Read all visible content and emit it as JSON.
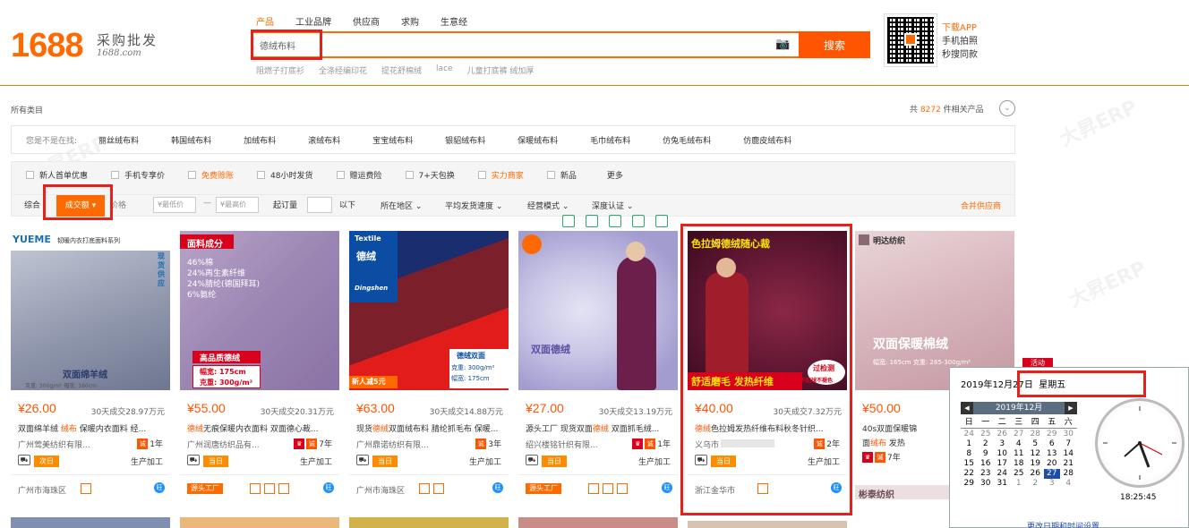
{
  "logo": {
    "brand": "1688",
    "slogan": "采购批发",
    "domain": "1688.com"
  },
  "search": {
    "tabs": [
      "产品",
      "工业品牌",
      "供应商",
      "求购",
      "生意经"
    ],
    "value": "德绒布料",
    "button": "搜索",
    "hot_words": [
      "阻燃子打底衫",
      "全涤经编印花",
      "提花舒棉绒",
      "lace",
      "儿童打底裤 绒加厚"
    ]
  },
  "app": {
    "line1": "下载APP",
    "line2": "手机拍照",
    "line3": "秒搜同款"
  },
  "crumb": "所有类目",
  "total": {
    "prefix": "共",
    "count": "8272",
    "suffix": "件相关产品"
  },
  "suggest": {
    "label": "您是不是在找:",
    "items": [
      "丽丝绒布料",
      "韩国绒布料",
      "加绒布料",
      "滚绒布料",
      "宝宝绒布料",
      "银貂绒布料",
      "保暖绒布料",
      "毛巾绒布料",
      "仿兔毛绒布料",
      "仿鹿皮绒布料"
    ]
  },
  "filters": {
    "checks": [
      {
        "label": "新人首单优惠",
        "orange": false
      },
      {
        "label": "手机专享价",
        "orange": false
      },
      {
        "label": "免费赊账",
        "orange": true
      },
      {
        "label": "48小时发货",
        "orange": false
      },
      {
        "label": "赠运费险",
        "orange": false
      },
      {
        "label": "7+天包换",
        "orange": false
      },
      {
        "label": "实力商家",
        "orange": true
      },
      {
        "label": "新品",
        "orange": false
      }
    ],
    "more": "更多",
    "sort_general": "综合",
    "sort_active": "成交额",
    "sort_price": "价格",
    "min_price": "¥最低价",
    "max_price": "¥最高价",
    "moq_label": "起订量",
    "moq_suffix": "以下",
    "region": "所在地区",
    "delivery": "平均发货速度",
    "mode": "经营模式",
    "cert": "深度认证",
    "merge": "合并供应商"
  },
  "products": [
    {
      "price": "¥26.00",
      "sold": "30天成交28.97万元",
      "title_a": "双面绵羊绒 ",
      "title_hl": "绒布",
      "title_b": " 保暖内衣面料 经...",
      "shop": "广州莺美纺织有限...",
      "tier": "1年",
      "tier_red": false,
      "today": "次日",
      "mfg": "生产加工",
      "loc": "广州市海珠区",
      "img_brand": "YUEME",
      "img_sub": "韧暖内衣打底面料系列",
      "img_caption": "双面绵羊绒",
      "img_side": "现货供应",
      "img_specs": "克重: 300g/m²  幅宽: 160cm"
    },
    {
      "price": "¥55.00",
      "sold": "30天成交20.31万元",
      "title_a": "",
      "title_hl": "德绒",
      "title_b": "无痕保暖内衣面料 双面德心裁...",
      "shop": "广州润唐纺织品有...",
      "tier": "7年",
      "tier_red": true,
      "today": "当日",
      "mfg": "生产加工",
      "loc": "源头工厂",
      "img_brand": "面料成分",
      "img_lines": [
        "46%棉",
        "24%再生素纤维",
        "24%腈纶(德国拜耳)",
        "6%氨纶"
      ],
      "img_caption": "高品质德绒",
      "img_specs1": "幅宽: 175cm",
      "img_specs2": "克重: 300g/m²"
    },
    {
      "price": "¥63.00",
      "sold": "30天成交14.88万元",
      "title_a": "现货",
      "title_hl": "德绒",
      "title_b": "双面绒布料 腈纶抓毛布 保暖...",
      "shop": "广州鼎诺纺织有限...",
      "tier": "3年",
      "tier_red": false,
      "today": "当日",
      "mfg": "生产加工",
      "loc": "广州市海珠区",
      "img_brand": "Textile",
      "img_sub": "德绒",
      "img_logo": "Dingshen",
      "img_new": "新人减5元",
      "img_tag": "德绒双面",
      "img_specs1": "克重: 300g/m²",
      "img_specs2": "幅宽: 175cm"
    },
    {
      "price": "¥27.00",
      "sold": "30天成交13.19万元",
      "title_a": "源头工厂 现货双面",
      "title_hl": "德绒",
      "title_b": " 双面抓毛绒...",
      "shop": "绍兴楼铭针织有限...",
      "tier": "1年",
      "tier_red": true,
      "today": "当日",
      "mfg": "生产加工",
      "loc": "源头工厂",
      "img_caption": "双面德绒"
    },
    {
      "price": "¥40.00",
      "sold": "30天成交7.32万元",
      "title_a": "",
      "title_hl": "德绒",
      "title_b": "色拉姆发热纤维布料秋冬针织...",
      "shop": "义乌市",
      "tier": "2年",
      "tier_red": false,
      "today": "当日",
      "mfg": "生产加工",
      "loc": "浙江金华市",
      "img_top": "色拉姆德绒随心裁",
      "img_bottom": "舒适磨毛 发热纤维",
      "img_seal1": "过检测",
      "img_seal2": "不起球不褪色"
    },
    {
      "price": "¥50.00",
      "sold": "",
      "title_a": "40s双面保暖锦",
      "title_hl": "",
      "title_b": "",
      "title2_a": "面",
      "title2_hl": "绒布",
      "title2_b": " 发热",
      "shop": "",
      "tier": "7年",
      "tier_red": true,
      "today": "",
      "mfg": "",
      "loc": "",
      "img_brand": "明达纺织",
      "img_caption": "双面保暖棉绒",
      "img_specs": "幅宽: 165cm 克重: 285-300g/m²",
      "footer_brand": "彬泰纺织"
    }
  ],
  "calendar": {
    "badge": "活动",
    "date": "2019年12月27日",
    "weekday": "星期五",
    "month": "2019年12月",
    "dow": [
      "日",
      "一",
      "二",
      "三",
      "四",
      "五",
      "六"
    ],
    "weeks": [
      [
        "24",
        "25",
        "26",
        "27",
        "28",
        "29",
        "30"
      ],
      [
        "1",
        "2",
        "3",
        "4",
        "5",
        "6",
        "7"
      ],
      [
        "8",
        "9",
        "10",
        "11",
        "12",
        "13",
        "14"
      ],
      [
        "15",
        "16",
        "17",
        "18",
        "19",
        "20",
        "21"
      ],
      [
        "22",
        "23",
        "24",
        "25",
        "26",
        "27",
        "28"
      ],
      [
        "29",
        "30",
        "31",
        "1",
        "2",
        "3",
        "4"
      ]
    ],
    "time": "18:25:45",
    "link": "更改日期和时间设置..."
  },
  "watermark": "大昇ERP",
  "colors": {
    "accent": "#ff6a00",
    "highlight": "#e6201a"
  }
}
